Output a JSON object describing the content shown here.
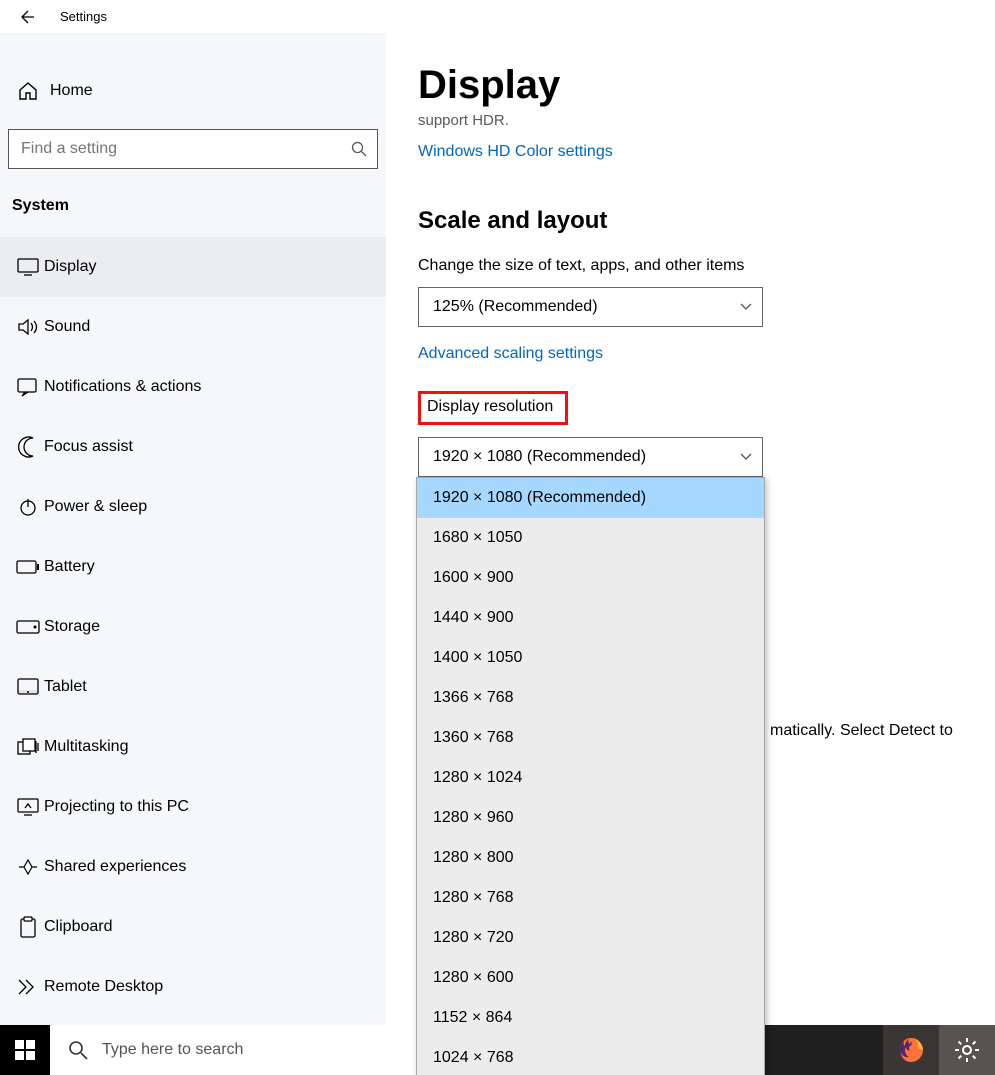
{
  "topbar": {
    "title": "Settings"
  },
  "sidebar": {
    "home": "Home",
    "search_placeholder": "Find a setting",
    "section": "System",
    "items": [
      {
        "label": "Display"
      },
      {
        "label": "Sound"
      },
      {
        "label": "Notifications & actions"
      },
      {
        "label": "Focus assist"
      },
      {
        "label": "Power & sleep"
      },
      {
        "label": "Battery"
      },
      {
        "label": "Storage"
      },
      {
        "label": "Tablet"
      },
      {
        "label": "Multitasking"
      },
      {
        "label": "Projecting to this PC"
      },
      {
        "label": "Shared experiences"
      },
      {
        "label": "Clipboard"
      },
      {
        "label": "Remote Desktop"
      }
    ]
  },
  "main": {
    "title": "Display",
    "hdr_sub": "support HDR.",
    "hdr_link": "Windows HD Color settings",
    "scale_h2": "Scale and layout",
    "scale_label": "Change the size of text, apps, and other items",
    "scale_value": "125% (Recommended)",
    "adv_link": "Advanced scaling settings",
    "res_label": "Display resolution",
    "res_value": "1920 × 1080 (Recommended)",
    "res_options": [
      "1920 × 1080 (Recommended)",
      "1680 × 1050",
      "1600 × 900",
      "1440 × 900",
      "1400 × 1050",
      "1366 × 768",
      "1360 × 768",
      "1280 × 1024",
      "1280 × 960",
      "1280 × 800",
      "1280 × 768",
      "1280 × 720",
      "1280 × 600",
      "1152 × 864",
      "1024 × 768"
    ],
    "obscured_text": "matically. Select Detect to"
  },
  "taskbar": {
    "search_placeholder": "Type here to search"
  }
}
